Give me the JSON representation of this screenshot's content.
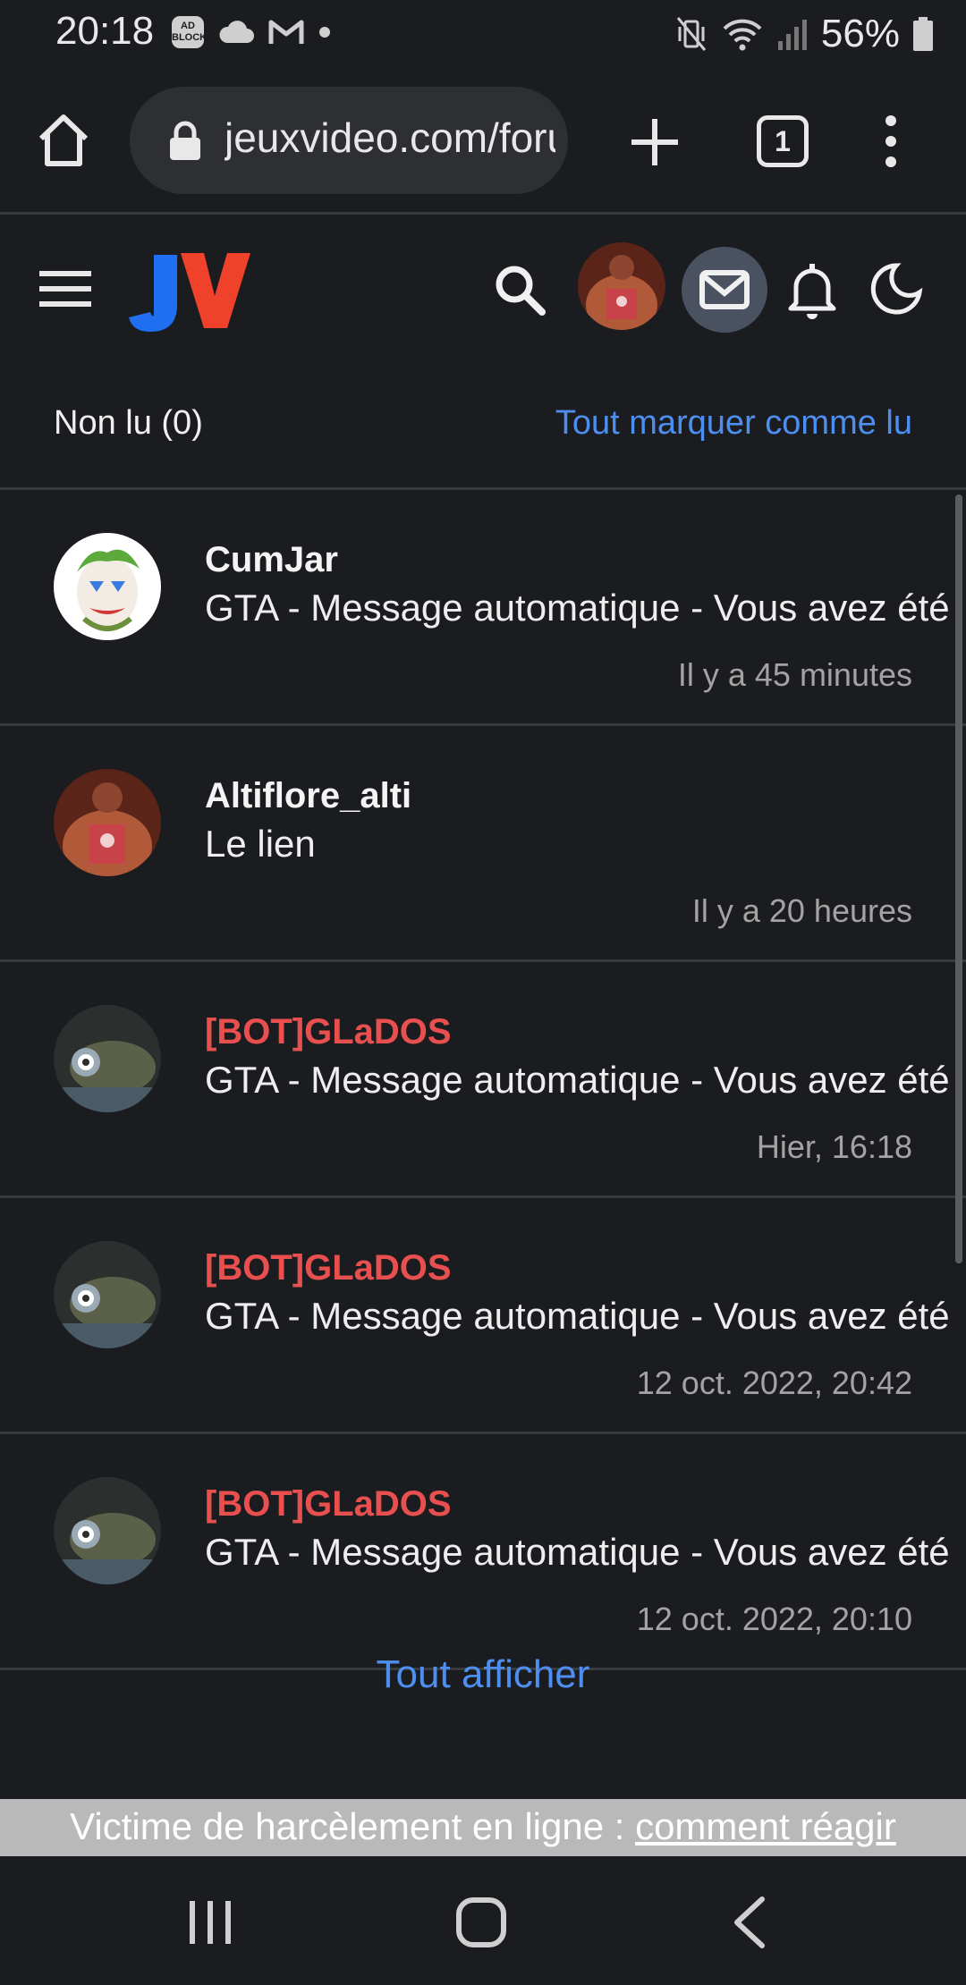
{
  "status_bar": {
    "time": "20:18",
    "adblock_label": "AD BLOCKER",
    "battery": "56%",
    "icons": [
      "adblock-icon",
      "cloud-icon",
      "gmail-icon",
      "dot-icon",
      "vibrate-icon",
      "wifi-icon",
      "signal-icon",
      "battery-icon"
    ]
  },
  "browser": {
    "url": "jeuxvideo.com/forums",
    "tab_count": "1"
  },
  "header": {
    "logo_text": "JV"
  },
  "messages_panel": {
    "unread_label": "Non lu (0)",
    "mark_all_label": "Tout marquer comme lu",
    "view_all_label": "Tout afficher",
    "items": [
      {
        "author": "CumJar",
        "subject": "GTA - Message automatique - Vous avez été",
        "date": "Il y a 45 minutes",
        "is_bot": false
      },
      {
        "author": "Altiflore_alti",
        "subject": "Le lien",
        "date": "Il y a 20 heures",
        "is_bot": false
      },
      {
        "author": "[BOT]GLaDOS",
        "subject": "GTA - Message automatique - Vous avez été",
        "date": "Hier, 16:18",
        "is_bot": true
      },
      {
        "author": "[BOT]GLaDOS",
        "subject": "GTA - Message automatique - Vous avez été",
        "date": "12 oct. 2022, 20:42",
        "is_bot": true
      },
      {
        "author": "[BOT]GLaDOS",
        "subject": "GTA - Message automatique - Vous avez été",
        "date": "12 oct. 2022, 20:10",
        "is_bot": true
      }
    ]
  },
  "harassment_banner": {
    "text": "Victime de harcèlement en ligne : ",
    "link": "comment réagir"
  },
  "colors": {
    "background": "#1b1c1f",
    "link_blue": "#4d8ff0",
    "bot_red": "#e8504f",
    "logo_blue": "#1f6ff0",
    "logo_red": "#f0412a"
  }
}
